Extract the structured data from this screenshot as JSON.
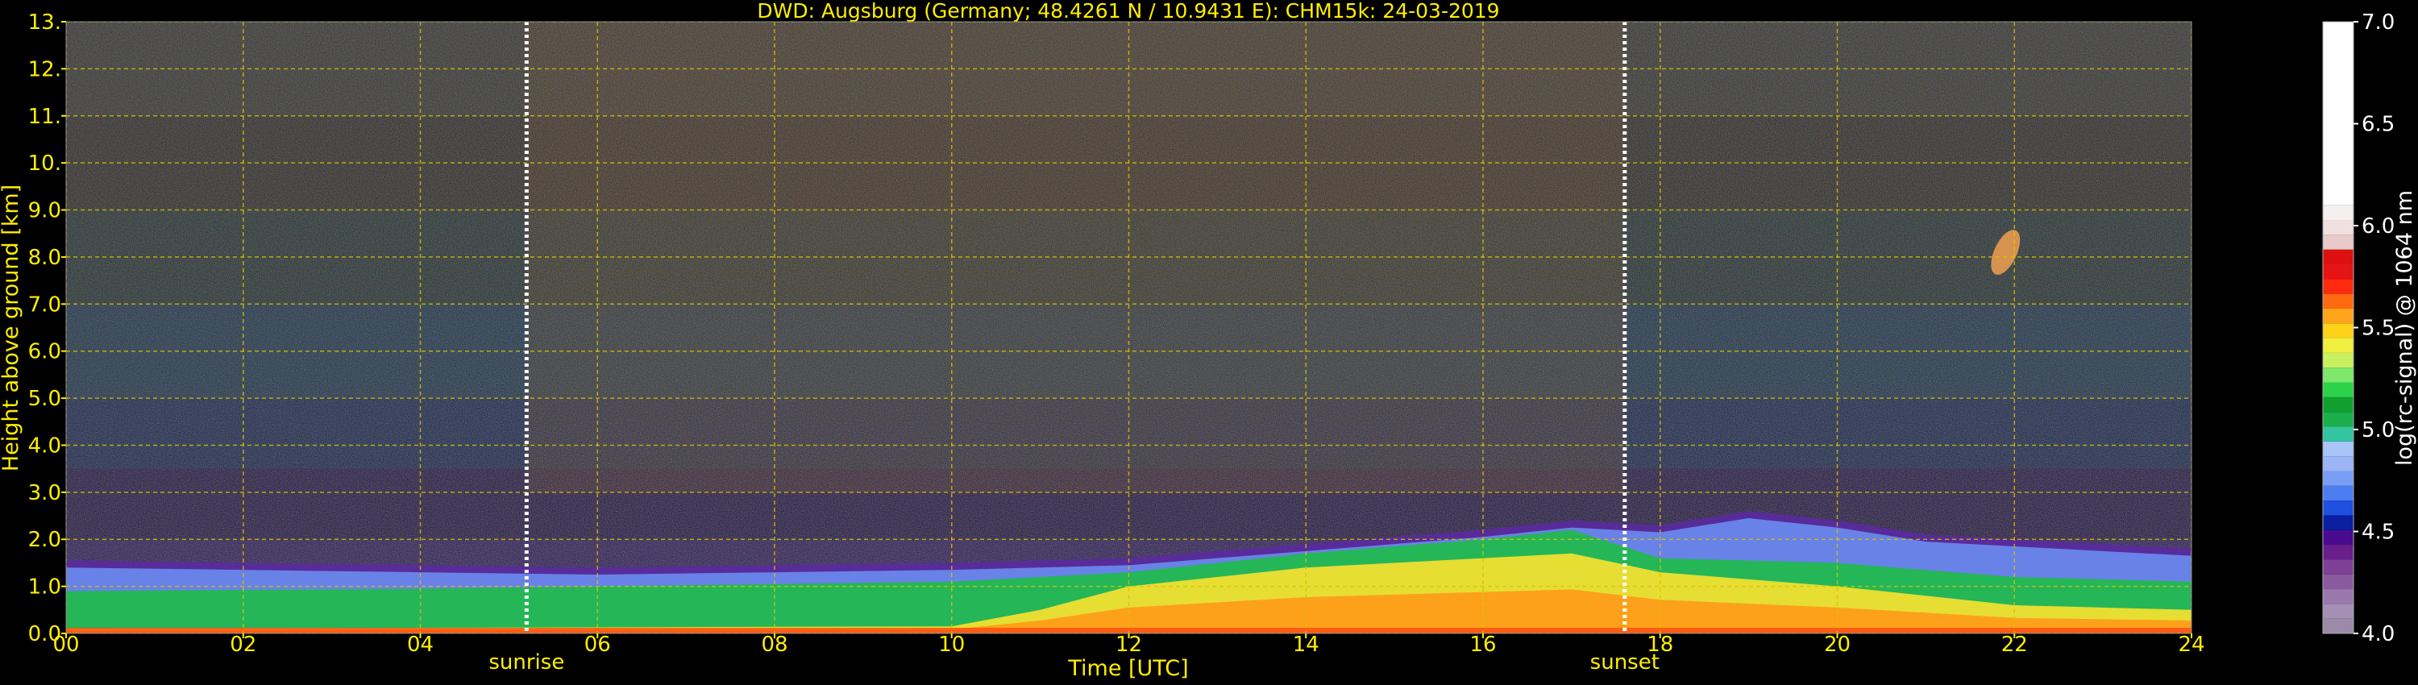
{
  "chart_data": {
    "type": "heatmap",
    "title": "DWD: Augsburg (Germany; 48.4261 N / 10.9431 E):    CHM15k: 24-03-2019",
    "xlabel": "Time [UTC]",
    "ylabel": "Height above ground [km]",
    "xlim": [
      0,
      24
    ],
    "ylim": [
      0,
      13
    ],
    "x_ticks": [
      "00",
      "02",
      "04",
      "06",
      "08",
      "10",
      "12",
      "14",
      "16",
      "18",
      "20",
      "22",
      "24"
    ],
    "y_ticks": [
      "0.0",
      "1.0",
      "2.0",
      "3.0",
      "4.0",
      "5.0",
      "6.0",
      "7.0",
      "8.0",
      "9.0",
      "10.",
      "11.",
      "12.",
      "13."
    ],
    "grid": true,
    "markers": [
      {
        "name": "sunrise",
        "x": 5.2
      },
      {
        "name": "sunset",
        "x": 17.6
      }
    ],
    "layers": {
      "boundary_layer_top_km": [
        [
          0,
          1.55
        ],
        [
          2,
          1.5
        ],
        [
          4,
          1.45
        ],
        [
          6,
          1.4
        ],
        [
          8,
          1.45
        ],
        [
          10,
          1.5
        ],
        [
          12,
          1.6
        ],
        [
          14,
          1.9
        ],
        [
          16,
          2.2
        ],
        [
          17,
          2.4
        ],
        [
          18,
          2.3
        ],
        [
          19,
          2.6
        ],
        [
          20,
          2.4
        ],
        [
          21,
          2.1
        ],
        [
          22,
          2.0
        ],
        [
          23,
          1.9
        ],
        [
          24,
          1.8
        ]
      ],
      "dense_aerosol_top_km": [
        [
          0,
          0.9
        ],
        [
          4,
          0.95
        ],
        [
          8,
          1.05
        ],
        [
          10,
          1.1
        ],
        [
          12,
          1.3
        ],
        [
          14,
          1.7
        ],
        [
          16,
          2.0
        ],
        [
          17,
          2.2
        ],
        [
          18,
          1.6
        ],
        [
          20,
          1.5
        ],
        [
          22,
          1.2
        ],
        [
          24,
          1.1
        ]
      ],
      "high_signal_top_km": [
        [
          0,
          0.1
        ],
        [
          10,
          0.15
        ],
        [
          11,
          0.5
        ],
        [
          12,
          1.0
        ],
        [
          14,
          1.4
        ],
        [
          16,
          1.6
        ],
        [
          17,
          1.7
        ],
        [
          18,
          1.3
        ],
        [
          20,
          1.0
        ],
        [
          22,
          0.6
        ],
        [
          24,
          0.5
        ]
      ],
      "cirrus_patch": {
        "x": 21.9,
        "height_km": 8.1
      }
    },
    "colorbar": {
      "label": "log(rc-signal) @ 1064 nm",
      "range": [
        4.0,
        7.0
      ],
      "ticks": [
        "4.0",
        "4.5",
        "5.0",
        "5.5",
        "6.0",
        "6.5",
        "7.0"
      ],
      "colors": [
        "#9b8aa8",
        "#a58fb5",
        "#9a78ac",
        "#8a5a9f",
        "#7f3f96",
        "#6a1e8c",
        "#4a0a8f",
        "#0a1fa0",
        "#1f50e0",
        "#4c7df0",
        "#7a9ef5",
        "#9db4f7",
        "#a8c4f8",
        "#33c4a0",
        "#1aaf4a",
        "#119f2e",
        "#2ad34a",
        "#7ee86a",
        "#c8f060",
        "#f0f040",
        "#ffd21a",
        "#ffa51a",
        "#ff6a10",
        "#ff2a10",
        "#e61414",
        "#dd1010",
        "#e8c8c8",
        "#f0e0e0",
        "#f4f0f0",
        "#ffffff"
      ]
    }
  }
}
